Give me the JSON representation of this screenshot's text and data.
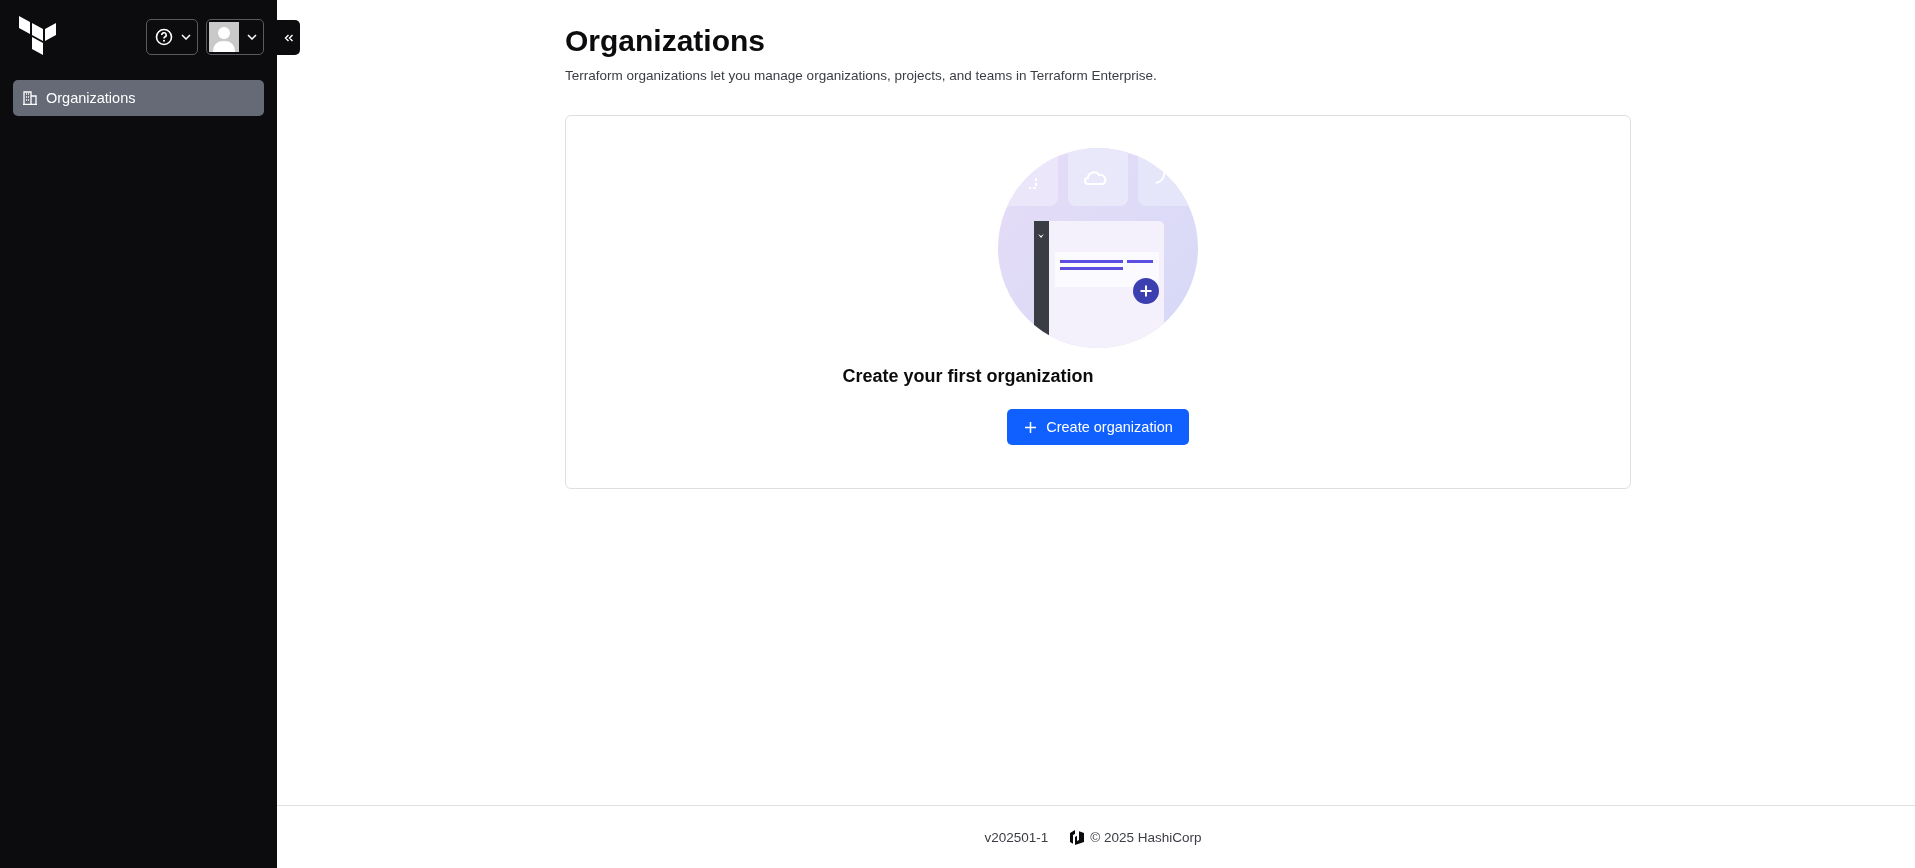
{
  "sidebar": {
    "items": [
      {
        "label": "Organizations",
        "selected": true
      }
    ]
  },
  "page": {
    "title": "Organizations",
    "description": "Terraform organizations let you manage organizations, projects, and teams in Terraform Enterprise."
  },
  "empty_state": {
    "heading": "Create your first organization",
    "button": "Create organization"
  },
  "footer": {
    "version": "v202501-1",
    "copyright": "© 2025 HashiCorp"
  }
}
